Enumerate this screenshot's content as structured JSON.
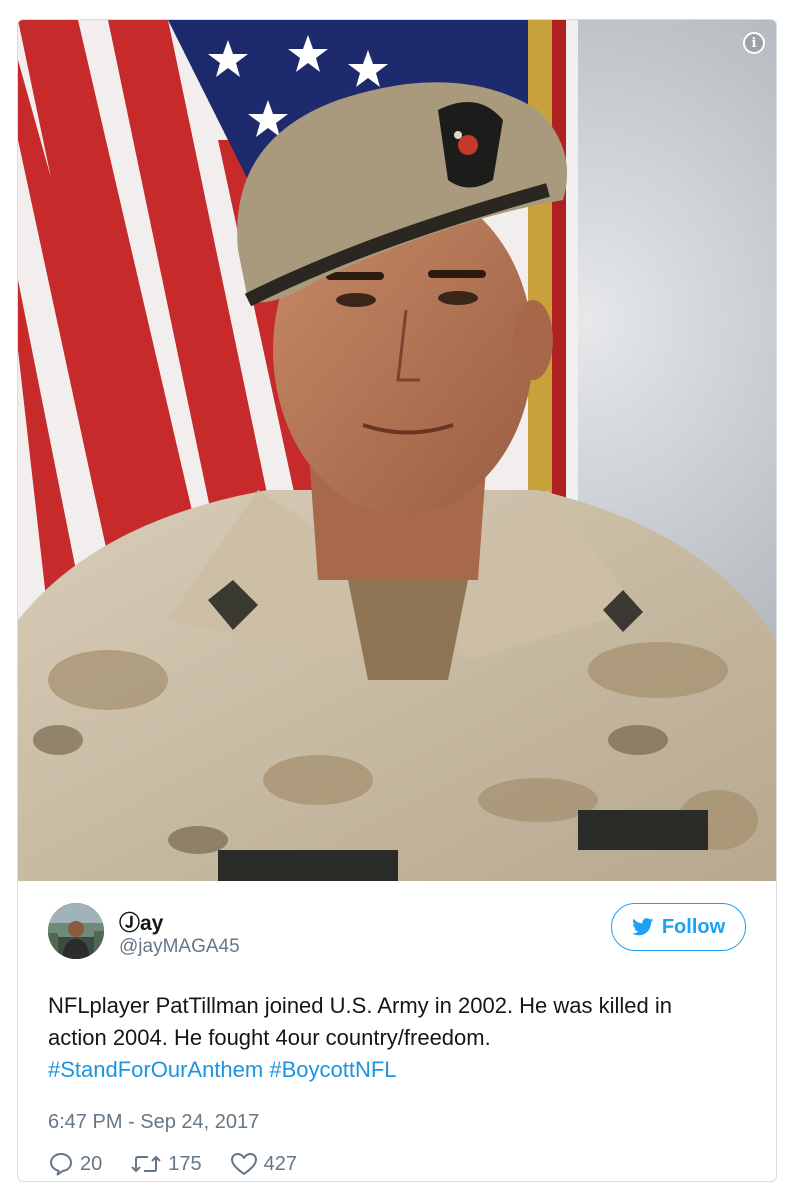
{
  "photo": {
    "description_icon": "info-icon",
    "info_glyph": "i"
  },
  "tweet": {
    "display_name": "Jay",
    "name_prefix_glyph": "Ⓙ",
    "name_rest": "ay",
    "handle": "@jayMAGA45",
    "follow_label": "Follow",
    "text_lines": [
      "NFLplayer PatTillman joined U.S. Army in 2002. He was killed in",
      "action 2004. He fought 4our country/freedom."
    ],
    "hashtags": [
      "#StandForOurAnthem",
      "#BoycottNFL"
    ],
    "timestamp": "6:47 PM - Sep 24, 2017",
    "replies": "20",
    "retweets": "175",
    "likes": "427"
  },
  "colors": {
    "accent": "#1da1f2",
    "hashtag": "#1b95e0",
    "muted": "#657786",
    "text": "#14171a",
    "border": "#d9dee2"
  },
  "icons": [
    "info-icon",
    "twitter-bird-icon",
    "reply-icon",
    "retweet-icon",
    "like-icon"
  ]
}
